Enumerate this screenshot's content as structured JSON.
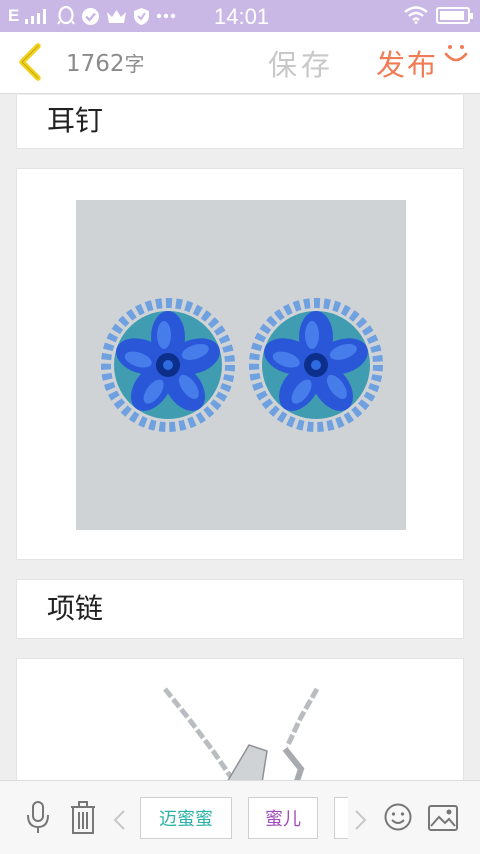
{
  "status_bar": {
    "carrier": "E",
    "time": "14:01"
  },
  "header": {
    "word_count": "1762",
    "word_count_unit": "字",
    "save_label": "保存",
    "publish_label": "发布"
  },
  "sections": [
    {
      "title": "耳钉"
    },
    {
      "title": "项链"
    }
  ],
  "toolbar": {
    "tags": [
      {
        "label": "迈蜜蜜",
        "color": "#2bb3a6"
      },
      {
        "label": "蜜儿",
        "color": "#a24bbd"
      }
    ]
  },
  "colors": {
    "publish": "#f07b55",
    "status_bar": "#c9b8e6"
  }
}
